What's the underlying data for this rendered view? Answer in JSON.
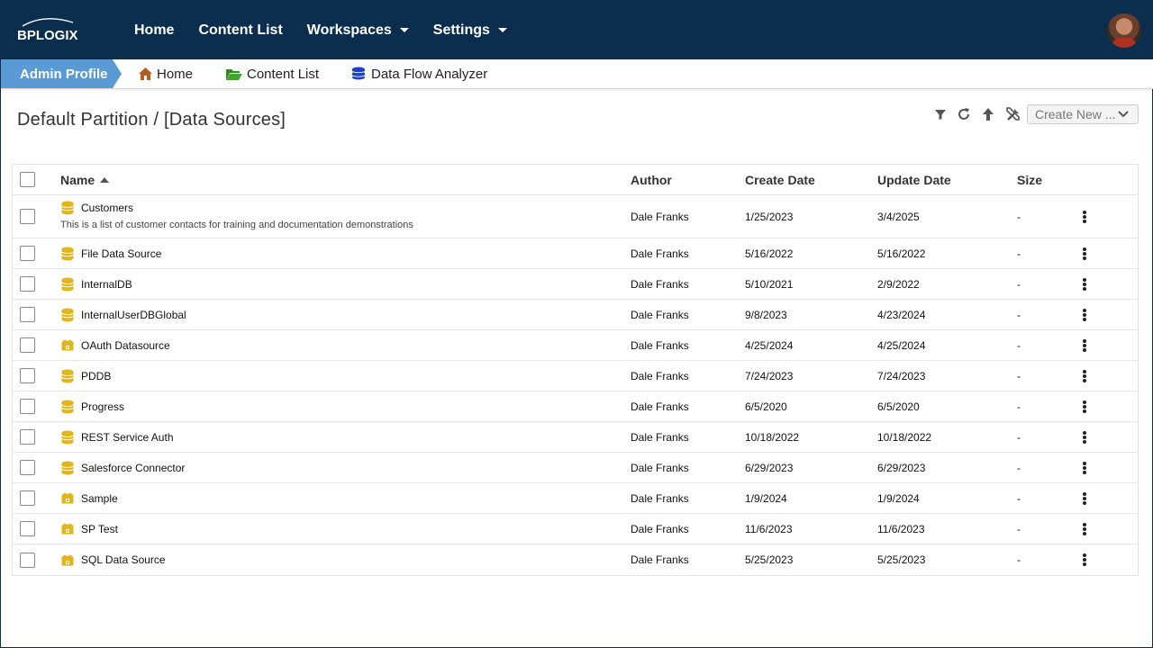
{
  "app": {
    "logo_text": "BPLOGIX"
  },
  "topnav": {
    "items": [
      {
        "label": "Home",
        "has_caret": false
      },
      {
        "label": "Content List",
        "has_caret": false
      },
      {
        "label": "Workspaces",
        "has_caret": true
      },
      {
        "label": "Settings",
        "has_caret": true
      }
    ]
  },
  "subnav": {
    "admin_profile": "Admin Profile",
    "links": [
      {
        "label": "Home",
        "icon": "home-icon"
      },
      {
        "label": "Content List",
        "icon": "folder-open-icon"
      },
      {
        "label": "Data Flow Analyzer",
        "icon": "database-stack-icon"
      }
    ]
  },
  "page": {
    "title": "Default Partition / [Data Sources]"
  },
  "toolbar": {
    "create_new_label": "Create New ...",
    "icons": [
      "filter-icon",
      "refresh-icon",
      "up-arrow-icon",
      "tools-icon"
    ]
  },
  "table": {
    "columns": {
      "name": "Name",
      "author": "Author",
      "create_date": "Create Date",
      "update_date": "Update Date",
      "size": "Size"
    },
    "sort": {
      "column": "name",
      "direction": "ascending"
    },
    "rows": [
      {
        "name": "Customers",
        "description": "This is a list of customer contacts for training and documentation demonstrations",
        "icon": "database-icon",
        "author": "Dale Franks",
        "create_date": "1/25/2023",
        "update_date": "3/4/2025",
        "size": "-"
      },
      {
        "name": "File Data Source",
        "description": "",
        "icon": "database-icon",
        "author": "Dale Franks",
        "create_date": "5/16/2022",
        "update_date": "5/16/2022",
        "size": "-"
      },
      {
        "name": "InternalDB",
        "description": "",
        "icon": "database-icon",
        "author": "Dale Franks",
        "create_date": "5/10/2021",
        "update_date": "2/9/2022",
        "size": "-"
      },
      {
        "name": "InternalUserDBGlobal",
        "description": "",
        "icon": "database-icon",
        "author": "Dale Franks",
        "create_date": "9/8/2023",
        "update_date": "4/23/2024",
        "size": "-"
      },
      {
        "name": "OAuth Datasource",
        "description": "",
        "icon": "web-service-icon",
        "author": "Dale Franks",
        "create_date": "4/25/2024",
        "update_date": "4/25/2024",
        "size": "-"
      },
      {
        "name": "PDDB",
        "description": "",
        "icon": "database-icon",
        "author": "Dale Franks",
        "create_date": "7/24/2023",
        "update_date": "7/24/2023",
        "size": "-"
      },
      {
        "name": "Progress",
        "description": "",
        "icon": "database-icon",
        "author": "Dale Franks",
        "create_date": "6/5/2020",
        "update_date": "6/5/2020",
        "size": "-"
      },
      {
        "name": "REST Service Auth",
        "description": "",
        "icon": "database-icon",
        "author": "Dale Franks",
        "create_date": "10/18/2022",
        "update_date": "10/18/2022",
        "size": "-"
      },
      {
        "name": "Salesforce Connector",
        "description": "",
        "icon": "database-icon",
        "author": "Dale Franks",
        "create_date": "6/29/2023",
        "update_date": "6/29/2023",
        "size": "-"
      },
      {
        "name": "Sample",
        "description": "",
        "icon": "web-service-icon",
        "author": "Dale Franks",
        "create_date": "1/9/2024",
        "update_date": "1/9/2024",
        "size": "-"
      },
      {
        "name": "SP Test",
        "description": "",
        "icon": "web-service-icon",
        "author": "Dale Franks",
        "create_date": "11/6/2023",
        "update_date": "11/6/2023",
        "size": "-"
      },
      {
        "name": "SQL Data Source",
        "description": "",
        "icon": "web-service-icon",
        "author": "Dale Franks",
        "create_date": "5/25/2023",
        "update_date": "5/25/2023",
        "size": "-"
      }
    ]
  },
  "colors": {
    "header_bg": "#0b2d4e",
    "admin_tab": "#5b9bd5",
    "icon_gold": "#e2b61a",
    "home_icon": "#b85c1e",
    "folder_icon": "#2e8b1f",
    "db_icon_blue": "#1f3fd1"
  }
}
